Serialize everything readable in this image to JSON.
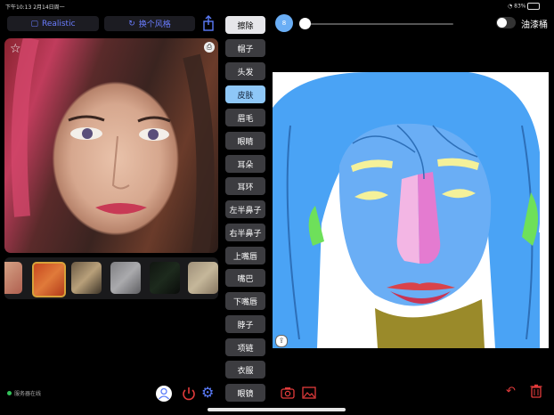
{
  "status": {
    "time": "下午10:13",
    "date": "2月14日周一",
    "battery": "83%"
  },
  "left": {
    "style_label": "Realistic",
    "switch_style_label": "换个风格",
    "server_status": "服务器在线"
  },
  "categories": [
    "擦除",
    "帽子",
    "头发",
    "皮肤",
    "眉毛",
    "眼睛",
    "耳朵",
    "耳环",
    "左半鼻子",
    "右半鼻子",
    "上嘴唇",
    "嘴巴",
    "下嘴唇",
    "脖子",
    "项链",
    "衣服",
    "眼镜"
  ],
  "active_category": "皮肤",
  "toolbar": {
    "brush_size_label": "8",
    "paint_bucket_label": "油漆桶"
  },
  "colors": {
    "accent": "#5b7cfa",
    "skin": "#6aaef5",
    "hair": "#4aa3f5",
    "danger": "#e23b3b"
  }
}
